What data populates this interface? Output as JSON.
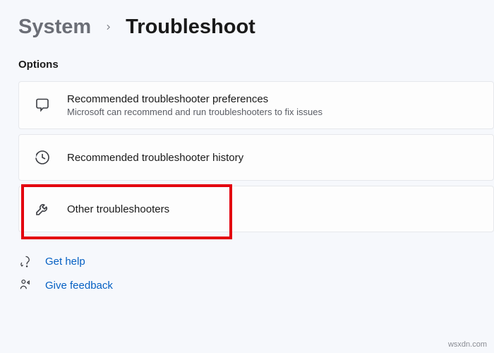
{
  "breadcrumb": {
    "root": "System",
    "current": "Troubleshoot"
  },
  "section_label": "Options",
  "options": {
    "preferences": {
      "title": "Recommended troubleshooter preferences",
      "subtitle": "Microsoft can recommend and run troubleshooters to fix issues"
    },
    "history": {
      "title": "Recommended troubleshooter history"
    },
    "other": {
      "title": "Other troubleshooters"
    }
  },
  "footer": {
    "help": "Get help",
    "feedback": "Give feedback"
  },
  "watermark": "wsxdn.com"
}
